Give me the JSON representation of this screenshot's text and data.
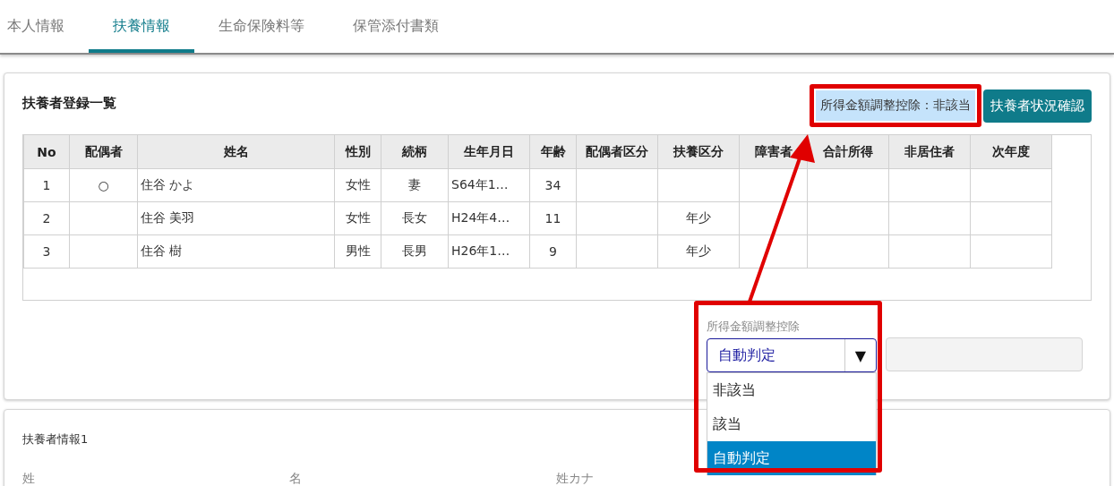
{
  "tabs": [
    {
      "label": "本人情報",
      "selected": false
    },
    {
      "label": "扶養情報",
      "selected": true
    },
    {
      "label": "生命保険料等",
      "selected": false
    },
    {
      "label": "保管添付書類",
      "selected": false
    }
  ],
  "list_panel": {
    "title": "扶養者登録一覧",
    "status_badge": "所得金額調整控除：非該当",
    "button": "扶養者状況確認",
    "table": {
      "columns": [
        "No",
        "配偶者",
        "姓名",
        "性別",
        "続柄",
        "生年月日",
        "年齢",
        "配偶者区分",
        "扶養区分",
        "障害者",
        "合計所得",
        "非居住者",
        "次年度"
      ],
      "rows": [
        {
          "no": "1",
          "spouse": "○",
          "name": "住谷 かよ",
          "sex": "女性",
          "relation": "妻",
          "birth": "S64年1…",
          "age": "34"
        },
        {
          "no": "2",
          "name": "住谷 美羽",
          "sex": "女性",
          "relation": "長女",
          "birth": "H24年4…",
          "age": "11",
          "dependent_class": "年少"
        },
        {
          "no": "3",
          "name": "住谷 樹",
          "sex": "男性",
          "relation": "長男",
          "birth": "H26年1…",
          "age": "9",
          "dependent_class": "年少"
        }
      ]
    }
  },
  "deduction_select": {
    "label": "所得金額調整控除",
    "value": "自動判定",
    "caret": "▼",
    "options": [
      {
        "label": "非該当",
        "selected": false
      },
      {
        "label": "該当",
        "selected": false
      },
      {
        "label": "自動判定",
        "selected": true
      }
    ]
  },
  "detail_panel": {
    "title": "扶養者情報1",
    "fields": [
      "姓",
      "名",
      "姓カナ"
    ]
  }
}
